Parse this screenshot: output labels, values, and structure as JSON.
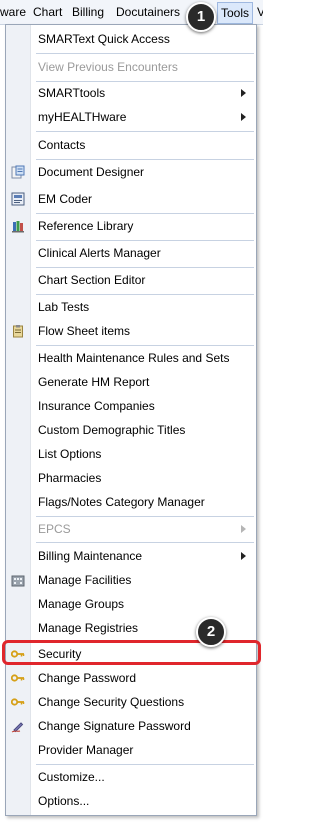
{
  "menubar": {
    "items": [
      "ware",
      "Chart",
      "Billing",
      "Docutainers",
      "Tools",
      "V"
    ],
    "active": "Tools"
  },
  "callouts": {
    "one": "1",
    "two": "2"
  },
  "tools_menu": {
    "items": [
      {
        "label": "SMARText Quick Access"
      },
      {
        "label": "View Previous Encounters",
        "disabled": true
      },
      {
        "label": "SMARTtools",
        "submenu": true
      },
      {
        "label": "myHEALTHware",
        "submenu": true
      },
      {
        "label": "Contacts"
      },
      {
        "label": "Document Designer",
        "icon": "document-designer-icon"
      },
      {
        "label": "EM Coder",
        "icon": "em-coder-icon"
      },
      {
        "label": "Reference Library",
        "icon": "reference-library-icon"
      },
      {
        "label": "Clinical Alerts Manager"
      },
      {
        "label": "Chart Section Editor"
      },
      {
        "label": "Lab Tests"
      },
      {
        "label": "Flow Sheet items",
        "icon": "clipboard-icon"
      },
      {
        "label": "Health Maintenance Rules and Sets"
      },
      {
        "label": "Generate HM Report"
      },
      {
        "label": "Insurance Companies"
      },
      {
        "label": "Custom Demographic Titles"
      },
      {
        "label": "List Options"
      },
      {
        "label": "Pharmacies"
      },
      {
        "label": "Flags/Notes Category Manager"
      },
      {
        "label": "EPCS",
        "disabled": true,
        "submenu": true
      },
      {
        "label": "Billing Maintenance",
        "submenu": true
      },
      {
        "label": "Manage Facilities",
        "icon": "facilities-icon"
      },
      {
        "label": "Manage Groups"
      },
      {
        "label": "Manage Registries"
      },
      {
        "label": "Security",
        "icon": "key-icon"
      },
      {
        "label": "Change Password",
        "icon": "key-icon"
      },
      {
        "label": "Change Security Questions",
        "icon": "key-icon"
      },
      {
        "label": "Change Signature Password",
        "icon": "signature-pen-icon"
      },
      {
        "label": "Provider Manager"
      },
      {
        "label": "Customize..."
      },
      {
        "label": "Options..."
      }
    ]
  },
  "colors": {
    "highlight": "#e0262c",
    "badge": "#2a2a2a"
  }
}
